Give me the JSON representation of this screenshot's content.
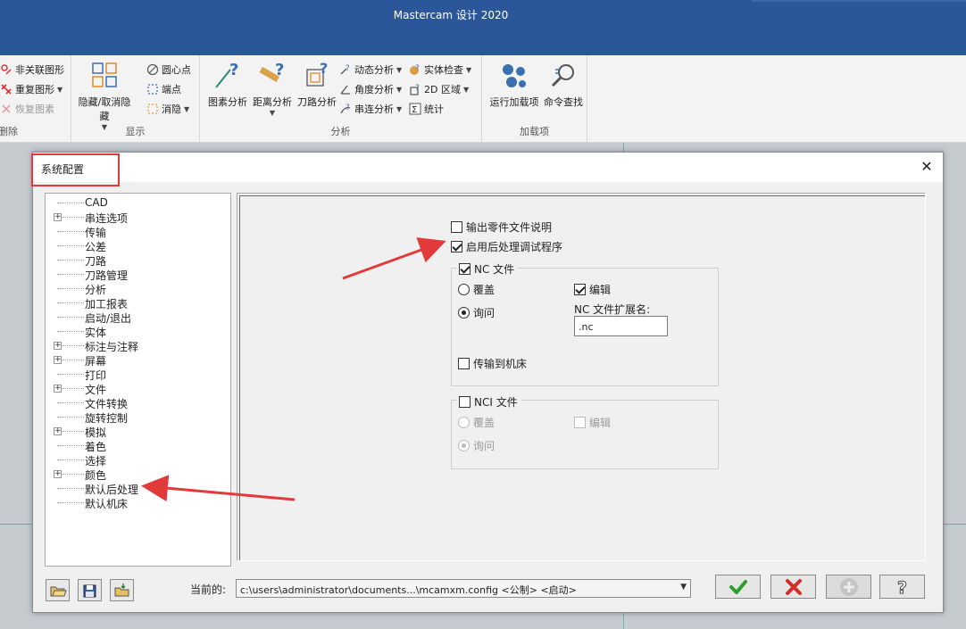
{
  "app": {
    "title": "Mastercam 设计 2020"
  },
  "ribbon": {
    "delete_group": {
      "label": "删除",
      "items": [
        {
          "label": "非关联图形",
          "icon": "unassociated-geometry-icon"
        },
        {
          "label": "重复图形",
          "icon": "duplicate-geometry-icon"
        },
        {
          "label": "恢复图素",
          "icon": "restore-entities-icon",
          "disabled": true
        }
      ]
    },
    "display_group": {
      "label": "显示",
      "big": {
        "label": "隐藏/取消隐藏",
        "icon": "hide-unhide-icon"
      },
      "items": [
        {
          "label": "圆心点",
          "icon": "arc-center-icon"
        },
        {
          "label": "端点",
          "icon": "endpoints-icon"
        },
        {
          "label": "消隐",
          "icon": "blank-icon"
        }
      ]
    },
    "analyze_group": {
      "label": "分析",
      "big": [
        {
          "label": "图素分析",
          "icon": "entity-analysis-icon"
        },
        {
          "label": "距离分析",
          "icon": "distance-analysis-icon"
        },
        {
          "label": "刀路分析",
          "icon": "toolpath-analysis-icon"
        }
      ],
      "items": [
        {
          "label": "动态分析",
          "icon": "dynamic-analysis-icon"
        },
        {
          "label": "角度分析",
          "icon": "angle-analysis-icon"
        },
        {
          "label": "串连分析",
          "icon": "chain-analysis-icon"
        },
        {
          "label": "实体检查",
          "icon": "solid-check-icon"
        },
        {
          "label": "2D 区域",
          "icon": "2d-area-icon"
        },
        {
          "label": "统计",
          "icon": "statistics-icon"
        }
      ]
    },
    "addins_group": {
      "label": "加载项",
      "big": [
        {
          "label": "运行加载项",
          "icon": "run-addin-icon"
        },
        {
          "label": "命令查找",
          "icon": "command-finder-icon"
        }
      ]
    }
  },
  "dialog": {
    "title": "系统配置",
    "tree": [
      {
        "label": "CAD",
        "expandable": false
      },
      {
        "label": "串连选项",
        "expandable": true
      },
      {
        "label": "传输",
        "expandable": false
      },
      {
        "label": "公差",
        "expandable": false
      },
      {
        "label": "刀路",
        "expandable": false
      },
      {
        "label": "刀路管理",
        "expandable": false
      },
      {
        "label": "分析",
        "expandable": false
      },
      {
        "label": "加工报表",
        "expandable": false
      },
      {
        "label": "启动/退出",
        "expandable": false
      },
      {
        "label": "实体",
        "expandable": false
      },
      {
        "label": "标注与注释",
        "expandable": true
      },
      {
        "label": "屏幕",
        "expandable": true
      },
      {
        "label": "打印",
        "expandable": false
      },
      {
        "label": "文件",
        "expandable": true
      },
      {
        "label": "文件转换",
        "expandable": false
      },
      {
        "label": "旋转控制",
        "expandable": false
      },
      {
        "label": "模拟",
        "expandable": true
      },
      {
        "label": "着色",
        "expandable": false
      },
      {
        "label": "选择",
        "expandable": false
      },
      {
        "label": "颜色",
        "expandable": true
      },
      {
        "label": "默认后处理",
        "expandable": false
      },
      {
        "label": "默认机床",
        "expandable": false
      }
    ],
    "options": {
      "output_part_doc": {
        "label": "输出零件文件说明",
        "checked": false
      },
      "enable_post_debug": {
        "label": "启用后处理调试程序",
        "checked": true
      }
    },
    "nc": {
      "label": "NC 文件",
      "checked": true,
      "overwrite": "覆盖",
      "ask": "询问",
      "selected": "ask",
      "edit": {
        "label": "编辑",
        "checked": true
      },
      "ext_label": "NC 文件扩展名:",
      "ext_value": ".nc",
      "send": {
        "label": "传输到机床",
        "checked": false
      }
    },
    "nci": {
      "label": "NCI 文件",
      "checked": false,
      "overwrite": "覆盖",
      "ask": "询问",
      "selected": "ask",
      "edit": {
        "label": "编辑",
        "checked": false
      }
    },
    "footer": {
      "current_label": "当前的:",
      "current_value": "c:\\users\\administrator\\documents...\\mcamxm.config <公制> <启动>",
      "buttons": [
        {
          "name": "ok-button",
          "icon": "check-icon",
          "color": "#2e9e2e"
        },
        {
          "name": "cancel-button",
          "icon": "x-icon",
          "color": "#d4302a"
        },
        {
          "name": "add-button",
          "icon": "plus-icon",
          "disabled": true
        },
        {
          "name": "help-button",
          "icon": "help-icon"
        }
      ]
    }
  },
  "colors": {
    "titlebar": "#2b579a",
    "annotation_red": "#e23a3a"
  }
}
